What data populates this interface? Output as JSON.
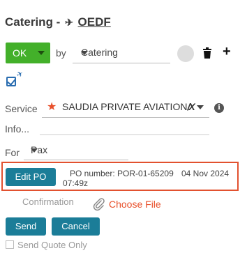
{
  "header": {
    "title_prefix": "Catering -",
    "registration": "OEDF"
  },
  "toolbar": {
    "status_label": "OK",
    "by_label": "by",
    "by_selected": "Catering"
  },
  "form": {
    "service_label": "Service",
    "service_value": "SAUDIA PRIVATE AVIATION",
    "service_logo_mark": "∕✖",
    "info_label": "Info...",
    "for_label": "For",
    "for_value": "Pax"
  },
  "po": {
    "edit_label": "Edit PO",
    "number_text": "PO number: POR-01-65209",
    "date_text": "04 Nov 2024",
    "time_text": "07:49z"
  },
  "confirmation": {
    "label": "Confirmation",
    "choose_file_label": "Choose File"
  },
  "actions": {
    "send_label": "Send",
    "cancel_label": "Cancel",
    "send_quote_only_label": "Send Quote Only"
  },
  "colors": {
    "ok_green": "#43b02a",
    "teal_button": "#1b7d98",
    "highlight_red": "#e2512f",
    "accent_orange": "#e8502b"
  }
}
